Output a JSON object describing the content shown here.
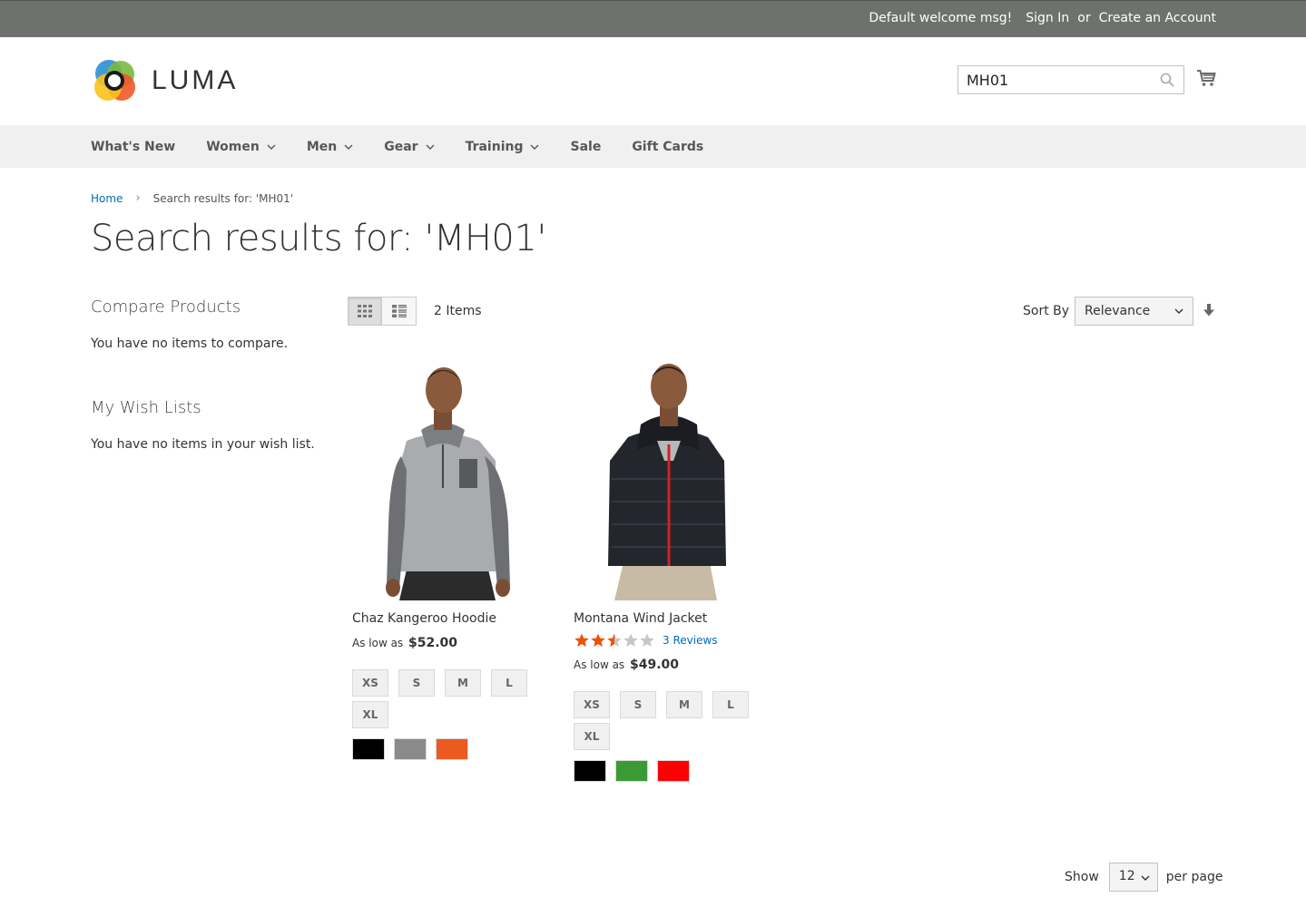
{
  "topbar": {
    "welcome": "Default welcome msg!",
    "sign_in": "Sign In",
    "or": "or",
    "create_account": "Create an Account"
  },
  "header": {
    "logo_text": "LUMA",
    "search_value": "MH01"
  },
  "nav": {
    "items": [
      {
        "label": "What's New",
        "has_dropdown": false
      },
      {
        "label": "Women",
        "has_dropdown": true
      },
      {
        "label": "Men",
        "has_dropdown": true
      },
      {
        "label": "Gear",
        "has_dropdown": true
      },
      {
        "label": "Training",
        "has_dropdown": true
      },
      {
        "label": "Sale",
        "has_dropdown": false
      },
      {
        "label": "Gift Cards",
        "has_dropdown": false
      }
    ]
  },
  "breadcrumb": {
    "home": "Home",
    "separator": "›",
    "current": "Search results for: 'MH01'"
  },
  "page_title": "Search results for: 'MH01'",
  "sidebar": {
    "compare_title": "Compare Products",
    "compare_text": "You have no items to compare.",
    "wishlist_title": "My Wish Lists",
    "wishlist_text": "You have no items in your wish list."
  },
  "toolbar": {
    "item_count": "2 Items",
    "sort_label": "Sort By",
    "sort_value": "Relevance",
    "view_mode": "grid"
  },
  "products": [
    {
      "name": "Chaz Kangeroo Hoodie",
      "price_prefix": "As low as",
      "price": "$52.00",
      "rating": null,
      "reviews": null,
      "sizes": [
        "XS",
        "S",
        "M",
        "L",
        "XL"
      ],
      "colors": [
        "#000000",
        "#8a8a8a",
        "#eb5a1e"
      ]
    },
    {
      "name": "Montana Wind Jacket",
      "price_prefix": "As low as",
      "price": "$49.00",
      "rating": 2.5,
      "reviews": "3  Reviews",
      "sizes": [
        "XS",
        "S",
        "M",
        "L",
        "XL"
      ],
      "colors": [
        "#000000",
        "#3a9b34",
        "#fe0000"
      ]
    }
  ],
  "limiter": {
    "show_label": "Show",
    "value": "12",
    "per_page_label": "per page"
  }
}
